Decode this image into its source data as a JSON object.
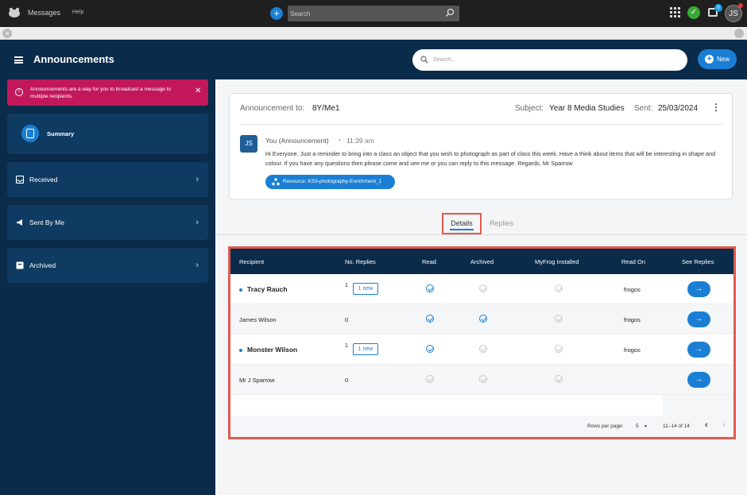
{
  "topbar": {
    "app_name": "Messages",
    "help_label": "Help",
    "search_placeholder": "Search",
    "notif_count": "0",
    "user_initials": "JS"
  },
  "header": {
    "title": "Announcements",
    "search_placeholder": "Search...",
    "new_label": "New"
  },
  "sidebar": {
    "alert_text": "Announcements are a way for you to broadcast a message to multiple recipients.",
    "items": [
      {
        "label": "Summary"
      },
      {
        "label": "Received"
      },
      {
        "label": "Sent By Me"
      },
      {
        "label": "Archived"
      }
    ]
  },
  "announcement": {
    "to_label": "Announcement to:",
    "to_value": "8Y/Me1",
    "subject_label": "Subject:",
    "subject_value": "Year 8 Media Studies",
    "sent_label": "Sent:",
    "sent_value": "25/03/2024",
    "avatar": "JS",
    "from": "You (Announcement)",
    "separator": "•",
    "time": "11:39 am",
    "message": "Hi Everyone, Just a reminder to bring into a class an object that you wish to photograph as part of class this week. Have a think about items that will be interesting in shape and colour. If you have any questions then please come and see me or you can reply to this message. Regards, Mr Sparrow",
    "resource_label": "Resource: KS3-photography-Enrichment_1"
  },
  "tabs": {
    "details": "Details",
    "replies": "Replies"
  },
  "table": {
    "headers": [
      "Recipient",
      "No. Replies",
      "Read",
      "Archived",
      "MyFrog Installed",
      "Read On",
      "See Replies"
    ],
    "rows": [
      {
        "name": "Tracy Rauch",
        "replies": "1",
        "new_badge": "1 new",
        "read": true,
        "archived": false,
        "myfrog": false,
        "read_on": "frogos",
        "unread": true
      },
      {
        "name": "James Wilson",
        "replies": "0",
        "new_badge": "",
        "read": true,
        "archived": true,
        "myfrog": false,
        "read_on": "frogos",
        "unread": false
      },
      {
        "name": "Monster Wilson",
        "replies": "1",
        "new_badge": "1 new",
        "read": true,
        "archived": false,
        "myfrog": false,
        "read_on": "frogos",
        "unread": true
      },
      {
        "name": "Mr J Sparrow",
        "replies": "0",
        "new_badge": "",
        "read": false,
        "archived": false,
        "myfrog": false,
        "read_on": "",
        "unread": false
      }
    ],
    "footer": {
      "rows_per_page_label": "Rows per page:",
      "rows_per_page_value": "5",
      "range": "11–14 of 14"
    }
  },
  "colors": {
    "navy": "#0b2b4a",
    "accent": "#1a7fd4",
    "alert": "#c2185b",
    "highlight": "#e05a4e"
  }
}
